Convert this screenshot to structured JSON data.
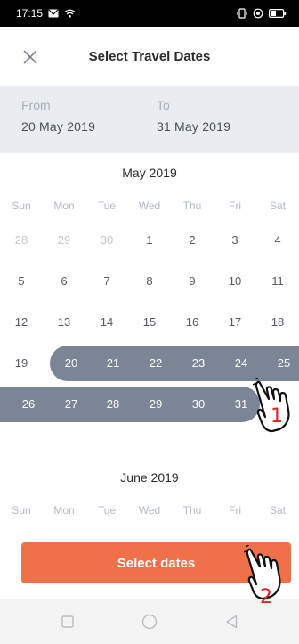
{
  "status": {
    "time": "17:15"
  },
  "header": {
    "title": "Select Travel Dates"
  },
  "range": {
    "from_label": "From",
    "from_value": "20 May 2019",
    "to_label": "To",
    "to_value": "31 May 2019"
  },
  "weekdays": [
    "Sun",
    "Mon",
    "Tue",
    "Wed",
    "Thu",
    "Fri",
    "Sat"
  ],
  "months": [
    {
      "title": "May 2019",
      "weeks": [
        [
          "28",
          "29",
          "30",
          "1",
          "2",
          "3",
          "4"
        ],
        [
          "5",
          "6",
          "7",
          "8",
          "9",
          "10",
          "11"
        ],
        [
          "12",
          "13",
          "14",
          "15",
          "16",
          "17",
          "18"
        ],
        [
          "19",
          "20",
          "21",
          "22",
          "23",
          "24",
          "25"
        ],
        [
          "26",
          "27",
          "28",
          "29",
          "30",
          "31",
          "1"
        ]
      ]
    },
    {
      "title": "June 2019"
    }
  ],
  "cta": {
    "label": "Select dates"
  },
  "annotations": {
    "step1": "1",
    "step2": "2"
  },
  "colors": {
    "accent": "#f0704a",
    "selection": "#7b8596",
    "panel": "#e9edf2"
  }
}
